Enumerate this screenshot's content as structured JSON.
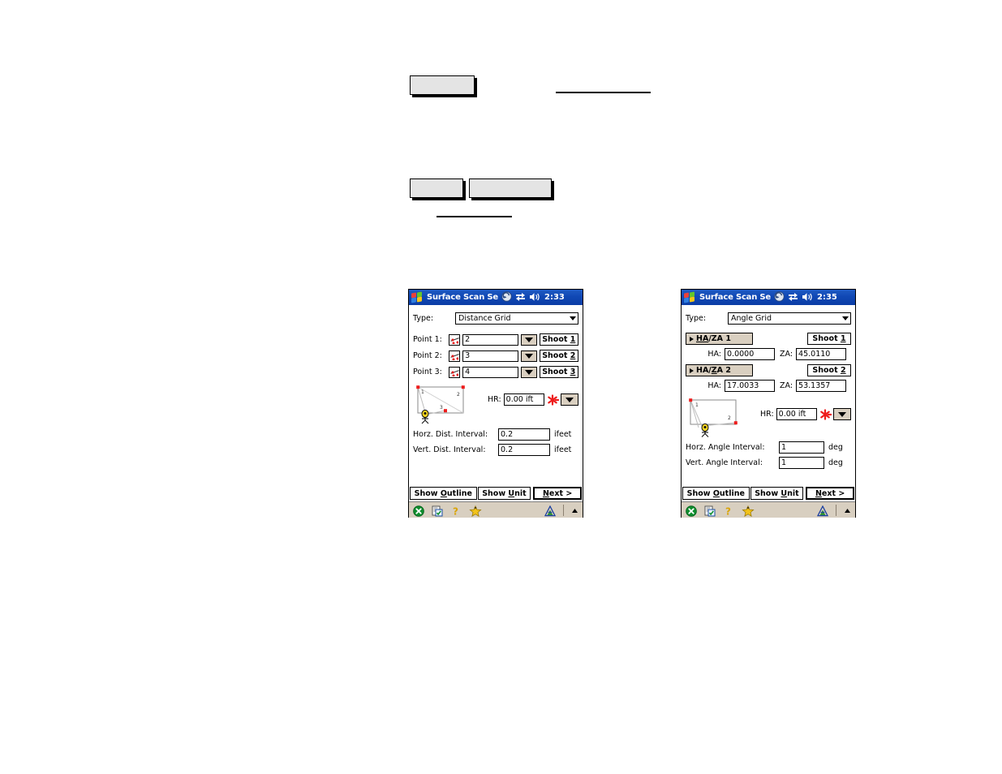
{
  "page": {
    "decorations": {
      "button_top": "",
      "button_mid_left": "",
      "button_mid_right": "",
      "rule_top": "",
      "rule_mid": ""
    }
  },
  "devices": [
    {
      "id": "distance-grid",
      "titlebar": {
        "title": "Surface Scan Se",
        "time": "2:33",
        "icons": [
          "windows-logo-icon",
          "rotate-screen-icon",
          "connectivity-icon",
          "speaker-icon"
        ]
      },
      "type_row": {
        "label": "Type:",
        "value": "Distance Grid"
      },
      "points": [
        {
          "label": "Point 1:",
          "value": "2",
          "shoot_label": "Shoot 1",
          "shoot_prefix": "Shoot ",
          "shoot_key": "1"
        },
        {
          "label": "Point 2:",
          "value": "3",
          "shoot_label": "Shoot 2",
          "shoot_prefix": "Shoot ",
          "shoot_key": "2"
        },
        {
          "label": "Point 3:",
          "value": "4",
          "shoot_label": "Shoot 3",
          "shoot_prefix": "Shoot ",
          "shoot_key": "3"
        }
      ],
      "diagram": {
        "point_labels": [
          "1",
          "2",
          "3"
        ]
      },
      "hr": {
        "label": "HR:",
        "value": "0.00 ift"
      },
      "intervals": [
        {
          "label": "Horz. Dist. Interval:",
          "value": "0.2",
          "unit": "ifeet"
        },
        {
          "label": "Vert. Dist. Interval:",
          "value": "0.2",
          "unit": "ifeet"
        }
      ],
      "buttons": {
        "show_outline": {
          "pre": "Show ",
          "key": "O",
          "post": "utline"
        },
        "show_unit": {
          "pre": "Show ",
          "key": "U",
          "post": "nit"
        },
        "next": {
          "pre": "",
          "key": "N",
          "post": "ext >"
        }
      },
      "taskbar": {
        "icons": [
          "close-icon",
          "input-panel-icon",
          "help-icon",
          "favorites-icon",
          "survey-icon",
          "up-arrow-icon"
        ]
      }
    },
    {
      "id": "angle-grid",
      "titlebar": {
        "title": "Surface Scan Se",
        "time": "2:35",
        "icons": [
          "windows-logo-icon",
          "rotate-screen-icon",
          "connectivity-icon",
          "speaker-icon"
        ]
      },
      "type_row": {
        "label": "Type:",
        "value": "Angle Grid"
      },
      "haza": [
        {
          "button": {
            "pre": "",
            "key": "HA",
            "post": "/ZA 1"
          },
          "button_text": "HA/ZA 1",
          "shoot_label": "Shoot 1",
          "shoot_prefix": "Shoot ",
          "shoot_key": "1",
          "ha_label": "HA:",
          "ha_value": "0.0000",
          "za_label": "ZA:",
          "za_value": "45.0110"
        },
        {
          "button": {
            "pre": "HA/",
            "key": "Z",
            "post": "A 2"
          },
          "button_text": "HA/ZA 2",
          "shoot_label": "Shoot 2",
          "shoot_prefix": "Shoot ",
          "shoot_key": "2",
          "ha_label": "HA:",
          "ha_value": "17.0033",
          "za_label": "ZA:",
          "za_value": "53.1357"
        }
      ],
      "diagram": {
        "point_labels": [
          "1",
          "2"
        ]
      },
      "hr": {
        "label": "HR:",
        "value": "0.00 ift"
      },
      "intervals": [
        {
          "label": "Horz. Angle Interval:",
          "value": "1",
          "unit": "deg"
        },
        {
          "label": "Vert. Angle Interval:",
          "value": "1",
          "unit": "deg"
        }
      ],
      "buttons": {
        "show_outline": {
          "pre": "Show ",
          "key": "O",
          "post": "utline"
        },
        "show_unit": {
          "pre": "Show ",
          "key": "U",
          "post": "nit"
        },
        "next": {
          "pre": "",
          "key": "N",
          "post": "ext >"
        }
      },
      "taskbar": {
        "icons": [
          "close-icon",
          "input-panel-icon",
          "help-icon",
          "favorites-icon",
          "survey-icon",
          "up-arrow-icon"
        ]
      }
    }
  ],
  "colors": {
    "titlebar_blue": "#0b3da6",
    "button_face": "#d9cfc0",
    "taskbar": "#d8cfc0",
    "point_red": "#ee1c1c",
    "doc_button_face": "#e4e4e4"
  }
}
